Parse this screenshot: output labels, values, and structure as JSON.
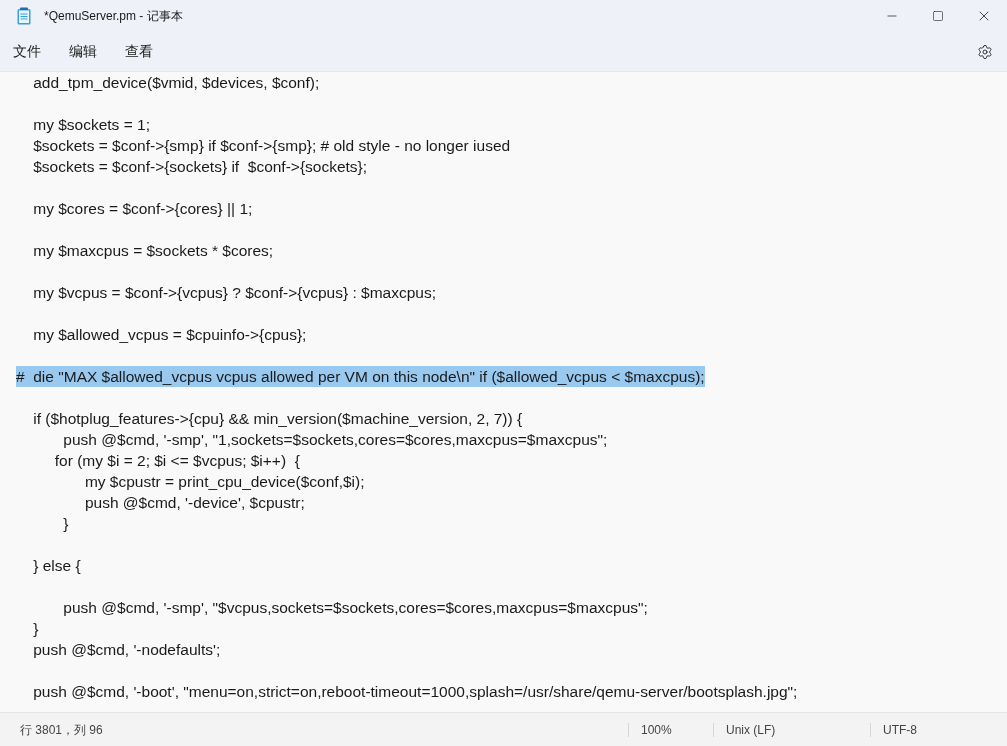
{
  "window": {
    "title": "*QemuServer.pm - 记事本"
  },
  "menu": [
    {
      "label": "文件"
    },
    {
      "label": "编辑"
    },
    {
      "label": "查看"
    }
  ],
  "editor": {
    "lines": [
      {
        "kind": "code",
        "text": "    add_tpm_device($vmid, $devices, $conf);",
        "selected": false
      },
      {
        "kind": "blank"
      },
      {
        "kind": "code",
        "text": "    my $sockets = 1;",
        "selected": false
      },
      {
        "kind": "code",
        "text": "    $sockets = $conf->{smp} if $conf->{smp}; # old style - no longer iused",
        "selected": false
      },
      {
        "kind": "code",
        "text": "    $sockets = $conf->{sockets} if  $conf->{sockets};",
        "selected": false
      },
      {
        "kind": "blank"
      },
      {
        "kind": "code",
        "text": "    my $cores = $conf->{cores} || 1;",
        "selected": false
      },
      {
        "kind": "blank"
      },
      {
        "kind": "code",
        "text": "    my $maxcpus = $sockets * $cores;",
        "selected": false
      },
      {
        "kind": "blank"
      },
      {
        "kind": "code",
        "text": "    my $vcpus = $conf->{vcpus} ? $conf->{vcpus} : $maxcpus;",
        "selected": false
      },
      {
        "kind": "blank"
      },
      {
        "kind": "code",
        "text": "    my $allowed_vcpus = $cpuinfo->{cpus};",
        "selected": false
      },
      {
        "kind": "blank"
      },
      {
        "kind": "code",
        "text": "#  die \"MAX $allowed_vcpus vcpus allowed per VM on this node\\n\" if ($allowed_vcpus < $maxcpus);",
        "selected": true
      },
      {
        "kind": "blank"
      },
      {
        "kind": "code",
        "text": "    if ($hotplug_features->{cpu} && min_version($machine_version, 2, 7)) {",
        "selected": false
      },
      {
        "kind": "code",
        "text": "           push @$cmd, '-smp', \"1,sockets=$sockets,cores=$cores,maxcpus=$maxcpus\";",
        "selected": false
      },
      {
        "kind": "code",
        "text": "         for (my $i = 2; $i <= $vcpus; $i++)  {",
        "selected": false
      },
      {
        "kind": "code",
        "text": "                my $cpustr = print_cpu_device($conf,$i);",
        "selected": false
      },
      {
        "kind": "code",
        "text": "                push @$cmd, '-device', $cpustr;",
        "selected": false
      },
      {
        "kind": "code",
        "text": "           }",
        "selected": false
      },
      {
        "kind": "blank"
      },
      {
        "kind": "code",
        "text": "    } else {",
        "selected": false
      },
      {
        "kind": "blank"
      },
      {
        "kind": "code",
        "text": "           push @$cmd, '-smp', \"$vcpus,sockets=$sockets,cores=$cores,maxcpus=$maxcpus\";",
        "selected": false
      },
      {
        "kind": "code",
        "text": "    }",
        "selected": false
      },
      {
        "kind": "code",
        "text": "    push @$cmd, '-nodefaults';",
        "selected": false
      },
      {
        "kind": "blank"
      },
      {
        "kind": "code",
        "text": "    push @$cmd, '-boot', \"menu=on,strict=on,reboot-timeout=1000,splash=/usr/share/qemu-server/bootsplash.jpg\";",
        "selected": false
      }
    ]
  },
  "status_bar": {
    "position": "行 3801，列 96",
    "zoom": "100%",
    "line_ending": "Unix (LF)",
    "encoding": "UTF-8"
  }
}
